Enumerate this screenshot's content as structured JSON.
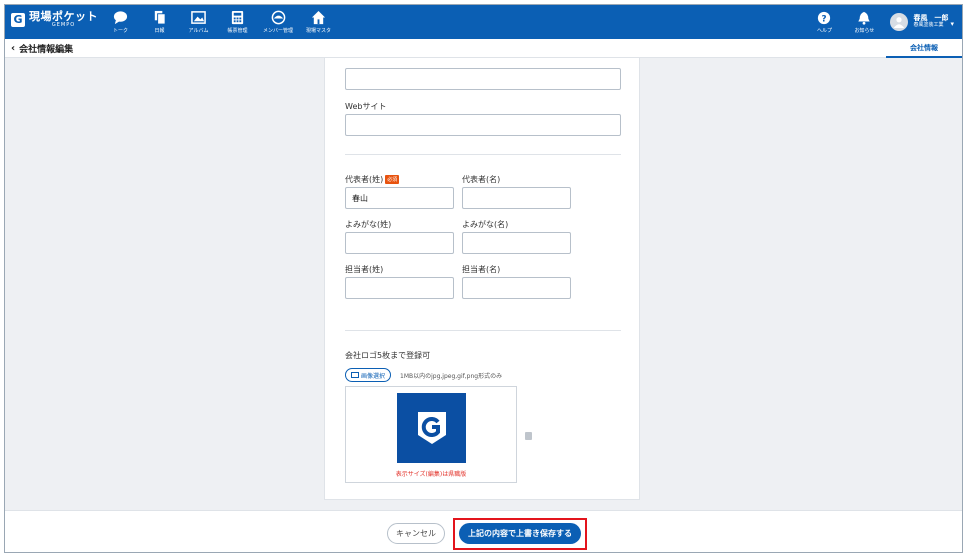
{
  "app": {
    "logo_text": "現場ポケット",
    "logo_sub": "GEMPO",
    "logo_mark": "G"
  },
  "nav": {
    "items": [
      {
        "label": "トーク",
        "icon": "chat-bubble-icon"
      },
      {
        "label": "日報",
        "icon": "documents-icon"
      },
      {
        "label": "アルバム",
        "icon": "photo-album-icon"
      },
      {
        "label": "帳票管理",
        "icon": "calculator-icon"
      },
      {
        "label": "メンバー管理",
        "icon": "helmet-icon"
      },
      {
        "label": "現場マスタ",
        "icon": "house-icon"
      }
    ]
  },
  "right_nav": {
    "help_label": "ヘルプ",
    "notice_label": "お知らせ",
    "user_name": "春風　一郎",
    "user_company": "春風塗装工業",
    "caret": "▾"
  },
  "subheader": {
    "back_label": "会社情報編集",
    "active_tab": "会社情報"
  },
  "form": {
    "top_field_value": "",
    "website_label": "Webサイト",
    "website_value": "",
    "rep_last_label": "代表者(姓)",
    "required_badge": "必須",
    "rep_last_value": "春山",
    "rep_first_label": "代表者(名)",
    "rep_first_value": "",
    "kana_last_label": "よみがな(姓)",
    "kana_last_value": "",
    "kana_first_label": "よみがな(名)",
    "kana_first_value": "",
    "staff_last_label": "担当者(姓)",
    "staff_last_value": "",
    "staff_first_label": "担当者(名)",
    "staff_first_value": "",
    "logo_section_label": "会社ロゴ5枚まで登録可",
    "image_select_label": "画像選択",
    "image_hint": "1MB以内のjpg,jpeg,gif,png形式のみ",
    "preview_note": "表示サイズ(編集)は県職版"
  },
  "footer": {
    "cancel_label": "キャンセル",
    "save_label": "上記の内容で上書き保存する"
  },
  "colors": {
    "brand": "#0b5fb4",
    "required": "#e8530f",
    "highlight": "#e3141c"
  }
}
